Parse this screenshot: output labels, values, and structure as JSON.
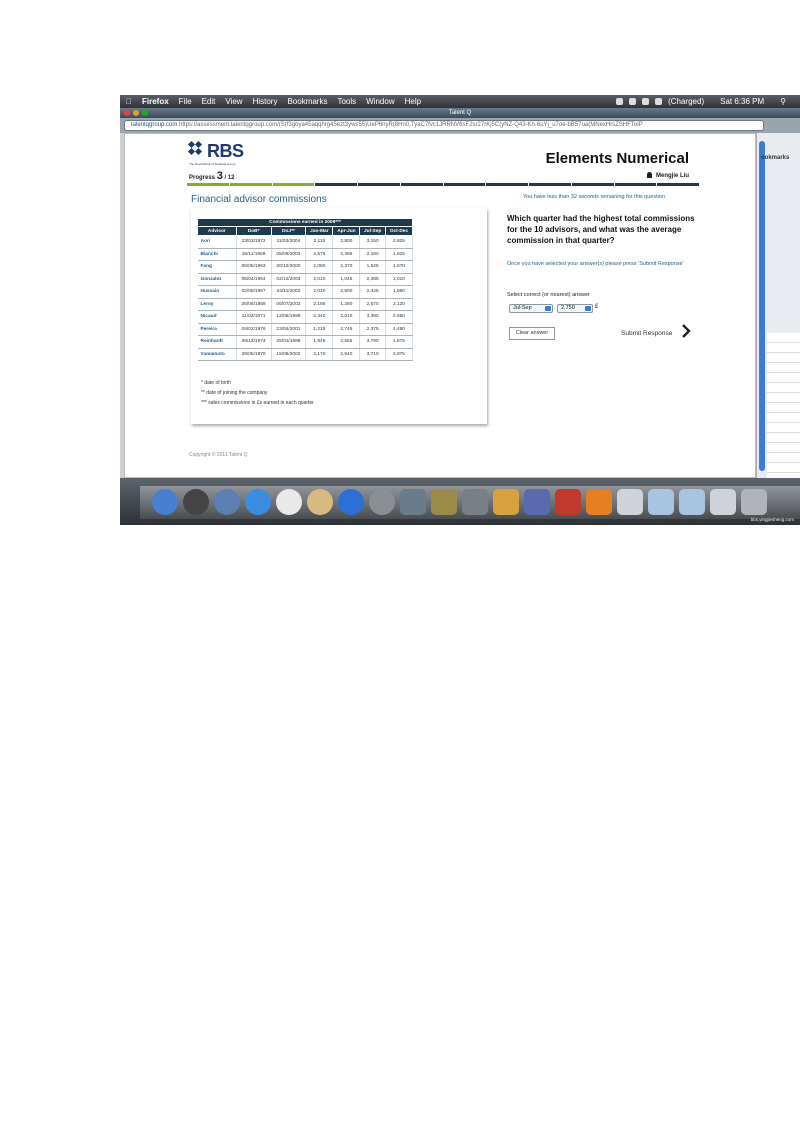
{
  "menubar": {
    "app": "Firefox",
    "items": [
      "File",
      "Edit",
      "View",
      "History",
      "Bookmarks",
      "Tools",
      "Window",
      "Help"
    ],
    "battery": "(Charged)",
    "clock": "Sat 6:36 PM"
  },
  "browser": {
    "window_title": "Talent Q",
    "url_domain": "talentqgroup.com",
    "url": "https://assessment.talentqgroup.com/(S(f3goya45aqqhrg45ezt3yws55)UeP6nyR(8Hn0,TyaC7fvc1JRRNV6sF2sr27rKj5C(yNZ-Q43-Kh-6uYj_u7oe-bB57ua(MNexHrsZSHFTolP",
    "sidebar_label": "ookmarks"
  },
  "header": {
    "logo": "RBS",
    "logo_sub": "The Royal Bank of Scotland Group",
    "product_title": "Elements Numerical",
    "progress_label": "Progress",
    "progress_current": "3",
    "progress_total": "/ 12",
    "progress_fraction": 0.25,
    "user": "Mengjie Liu"
  },
  "content": {
    "section_title": "Financial advisor commissions",
    "time_left": "You have less than 32 seconds remaining for this question"
  },
  "table": {
    "caption": "Commissions earned in 2009***",
    "columns": [
      "Advisor",
      "DoB*",
      "DoJ**",
      "Jan-Mar",
      "Apr-Jun",
      "Jul-Sep",
      "Oct-Dec"
    ],
    "rows": [
      [
        "Aori",
        "23/03/1972",
        "11/03/2004",
        "2,115",
        "2,800",
        "3,150",
        "2,825"
      ],
      [
        "Bianchi",
        "15/11/1969",
        "05/06/2003",
        "2,575",
        "2,365",
        "2,180",
        "1,825"
      ],
      [
        "Fang",
        "06/05/1963",
        "20/12/2000",
        "2,080",
        "2,370",
        "1,525",
        "1,670"
      ],
      [
        "Gonzalez",
        "05/04/1964",
        "02/12/2003",
        "2,010",
        "1,045",
        "2,385",
        "2,010"
      ],
      [
        "Hussain",
        "02/05/1967",
        "24/11/2002",
        "2,010",
        "2,500",
        "2,425",
        "1,560"
      ],
      [
        "Leroy",
        "25/06/1959",
        "06/07/2003",
        "2,185",
        "1,280",
        "2,570",
        "2,120"
      ],
      [
        "Nicaud",
        "11/03/1971",
        "12/05/1999",
        "2,340",
        "2,010",
        "3,390",
        "2,650"
      ],
      [
        "Pereira",
        "04/02/1976",
        "23/04/2001",
        "1,215",
        "2,745",
        "2,375",
        "1,480"
      ],
      [
        "Reinhardt",
        "28/12/1974",
        "25/01/1999",
        "1,945",
        "2,555",
        "3,790",
        "1,875"
      ],
      [
        "Yamamoto",
        "29/05/1970",
        "15/06/2002",
        "2,170",
        "2,940",
        "3,710",
        "2,875"
      ]
    ],
    "notes": [
      "* date of birth",
      "** date of joining the company",
      "*** sales commissions in £s earned in each quarter"
    ]
  },
  "question": {
    "text": "Which quarter had the highest total commissions for the 10 advisors, and what was the average commission in that quarter?",
    "instruction": "Once you have selected your answer(s) please press 'Submit Response'",
    "select_label": "Select correct (or nearest) answer",
    "quarter_selected": "Jul-Sep",
    "amount_selected": "2,750",
    "currency": "£",
    "clear_label": "Clear answer",
    "submit_label": "Submit Response"
  },
  "footer": {
    "copyright": "Copyright © 2011 Talent Q"
  },
  "dock": {
    "watermark": "bbs.yingjiesheng.com",
    "colors": [
      "#4a7fcf",
      "#444444",
      "#5a7fb0",
      "#3b8de0",
      "#e9e9e9",
      "#d8b980",
      "#2c6fd6",
      "#8a8f96",
      "#6a7b8c",
      "#9b8a4a",
      "#7a7f86",
      "#d9a040",
      "#5a6ab0",
      "#c0392b",
      "#e67e22",
      "#d0d4da",
      "#a8c4e0",
      "#a8c4e0",
      "#cfd3d8",
      "#b0b4b8"
    ]
  }
}
